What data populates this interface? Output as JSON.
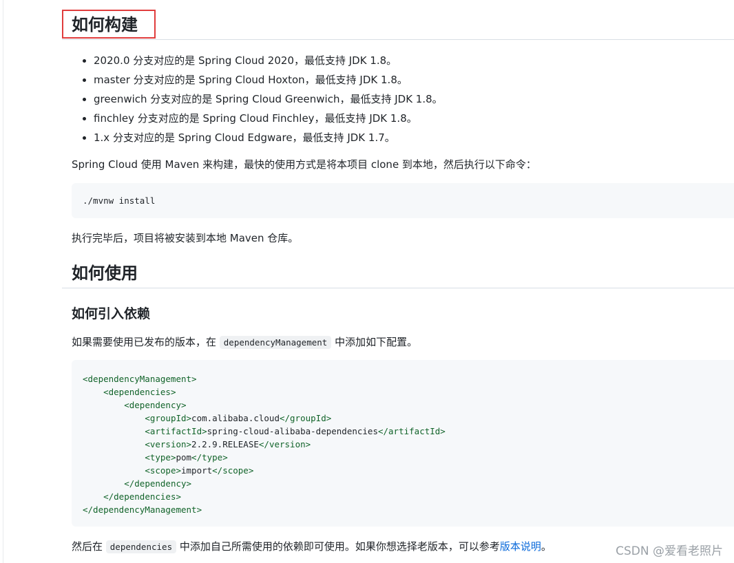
{
  "section_build": {
    "heading": "如何构建",
    "branches": [
      "2020.0 分支对应的是 Spring Cloud 2020，最低支持 JDK 1.8。",
      "master 分支对应的是 Spring Cloud Hoxton，最低支持 JDK 1.8。",
      "greenwich 分支对应的是 Spring Cloud Greenwich，最低支持 JDK 1.8。",
      "finchley 分支对应的是 Spring Cloud Finchley，最低支持 JDK 1.8。",
      "1.x 分支对应的是 Spring Cloud Edgware，最低支持 JDK 1.7。"
    ],
    "intro": "Spring Cloud 使用 Maven 来构建，最快的使用方式是将本项目 clone 到本地，然后执行以下命令：",
    "command": "./mvnw install",
    "after": "执行完毕后，项目将被安装到本地 Maven 仓库。"
  },
  "section_use": {
    "heading": "如何使用",
    "subheading": "如何引入依赖",
    "intro_before": "如果需要使用已发布的版本，在 ",
    "intro_code": "dependencyManagement",
    "intro_after": " 中添加如下配置。",
    "xml": {
      "l1_open": "<dependencyManagement>",
      "l2_open": "<dependencies>",
      "l3_open": "<dependency>",
      "groupId_open": "<groupId>",
      "groupId_value": "com.alibaba.cloud",
      "groupId_close": "</groupId>",
      "artifactId_open": "<artifactId>",
      "artifactId_value": "spring-cloud-alibaba-dependencies",
      "artifactId_close": "</artifactId>",
      "version_open": "<version>",
      "version_value": "2.2.9.RELEASE",
      "version_close": "</version>",
      "type_open": "<type>",
      "type_value": "pom",
      "type_close": "</type>",
      "scope_open": "<scope>",
      "scope_value": "import",
      "scope_close": "</scope>",
      "l3_close": "</dependency>",
      "l2_close": "</dependencies>",
      "l1_close": "</dependencyManagement>"
    },
    "footer_before": "然后在 ",
    "footer_code": "dependencies",
    "footer_middle": " 中添加自己所需使用的依赖即可使用。如果你想选择老版本，可以参考",
    "footer_link": "版本说明",
    "footer_end": "。"
  },
  "watermark": "CSDN @爱看老照片",
  "colors": {
    "highlight_border": "#e03c3c",
    "link": "#0969da",
    "xml_tag": "#116329",
    "code_background": "#f6f8fa"
  }
}
